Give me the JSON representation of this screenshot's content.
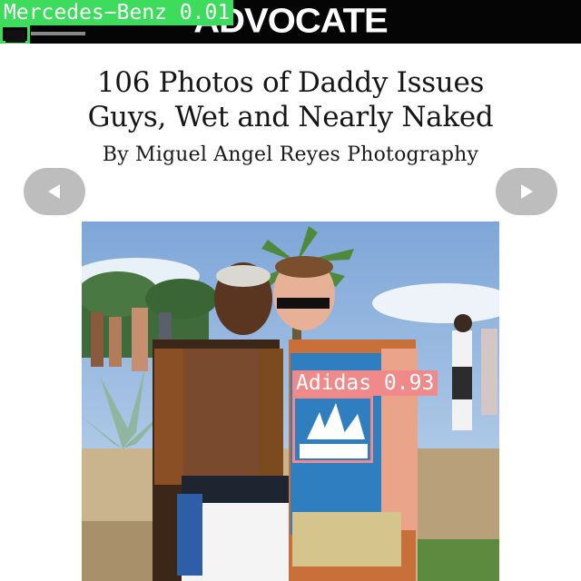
{
  "header": {
    "logo_text": "ADVOCATE",
    "background": "#050505"
  },
  "article": {
    "title_line1": "106 Photos of Daddy Issues",
    "title_line2": "Guys, Wet and Nearly Naked",
    "byline": "By Miguel Angel Reyes Photography"
  },
  "gallery": {
    "prev_icon": "triangle-left-icon",
    "next_icon": "triangle-right-icon",
    "button_color": "#bdbdbd"
  },
  "detections": [
    {
      "label": "Mercedes-Benz",
      "score": "0.01",
      "text": "Mercedes−Benz 0.01",
      "color": "#3ddc5c"
    },
    {
      "label": "Adidas",
      "score": "0.93",
      "text": "Adidas 0.93",
      "color": "#f08a8a"
    }
  ]
}
